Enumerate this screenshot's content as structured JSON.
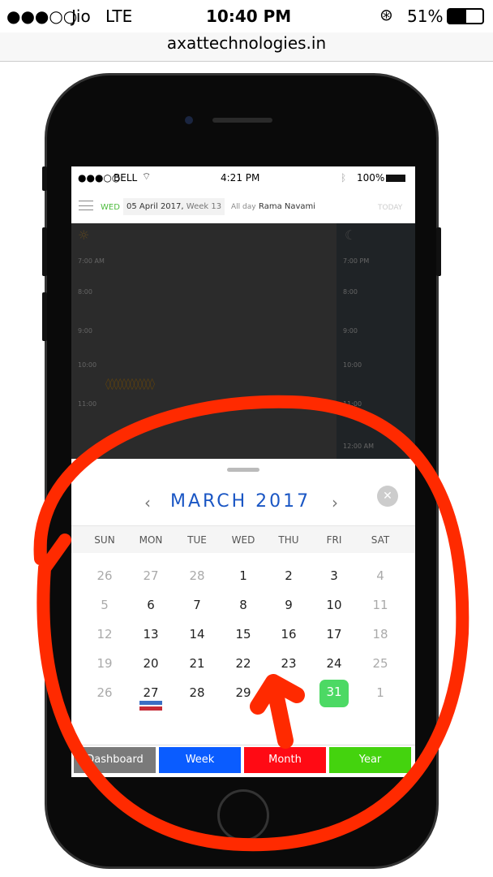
{
  "status_bar": {
    "signal": "●●●○○",
    "carrier": "Jio",
    "network": "LTE",
    "time": "10:40 PM",
    "battery": "51%"
  },
  "url_bar": {
    "url": "axattechnologies.in"
  },
  "inner_status": {
    "signal": "●●●○○",
    "carrier": "BELL",
    "time": "4:21 PM",
    "battery": "100%"
  },
  "header": {
    "weekday": "WED",
    "date": "05 April 2017,",
    "week": "Week 13",
    "allday_label": "All day",
    "event": "Rama Navami",
    "today": "TODAY"
  },
  "timeline": {
    "left": [
      "7:00 AM",
      "8:00",
      "9:00",
      "10:00",
      "11:00"
    ],
    "right": [
      "7:00 PM",
      "8:00",
      "9:00",
      "10:00",
      "11:00",
      "12:00 AM"
    ]
  },
  "calendar": {
    "title": "MARCH 2017",
    "prev": "‹",
    "next": "›",
    "weekdays": [
      "SUN",
      "MON",
      "TUE",
      "WED",
      "THU",
      "FRI",
      "SAT"
    ],
    "weeks": [
      [
        "26",
        "27",
        "28",
        "1",
        "2",
        "3",
        "4"
      ],
      [
        "5",
        "6",
        "7",
        "8",
        "9",
        "10",
        "11"
      ],
      [
        "12",
        "13",
        "14",
        "15",
        "16",
        "17",
        "18"
      ],
      [
        "19",
        "20",
        "21",
        "22",
        "23",
        "24",
        "25"
      ],
      [
        "26",
        "27",
        "28",
        "29",
        "",
        "31",
        "1"
      ]
    ],
    "selected": "31",
    "accent": "#1a56c4",
    "selected_color": "#4cd964"
  },
  "tabs": [
    {
      "label": "Dashboard",
      "color": "#7a7a7a"
    },
    {
      "label": "Week",
      "color": "#0a5cff"
    },
    {
      "label": "Month",
      "color": "#ff0a14"
    },
    {
      "label": "Year",
      "color": "#44d30e"
    }
  ],
  "annotation_color": "#ff2a00"
}
